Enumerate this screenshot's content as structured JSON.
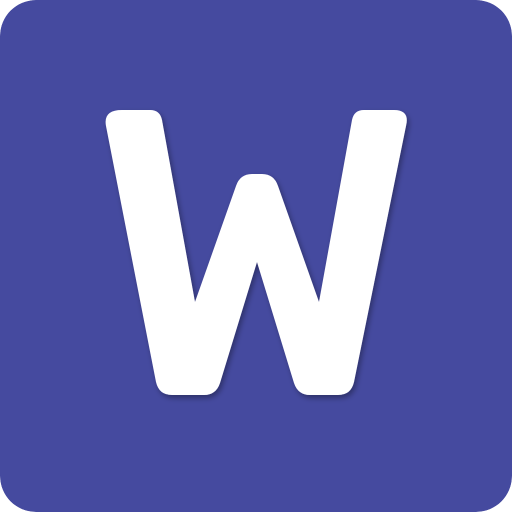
{
  "icon": {
    "name": "W app icon",
    "letter": "W",
    "background_color": "#454A9F",
    "glyph_color": "#FFFFFF"
  }
}
